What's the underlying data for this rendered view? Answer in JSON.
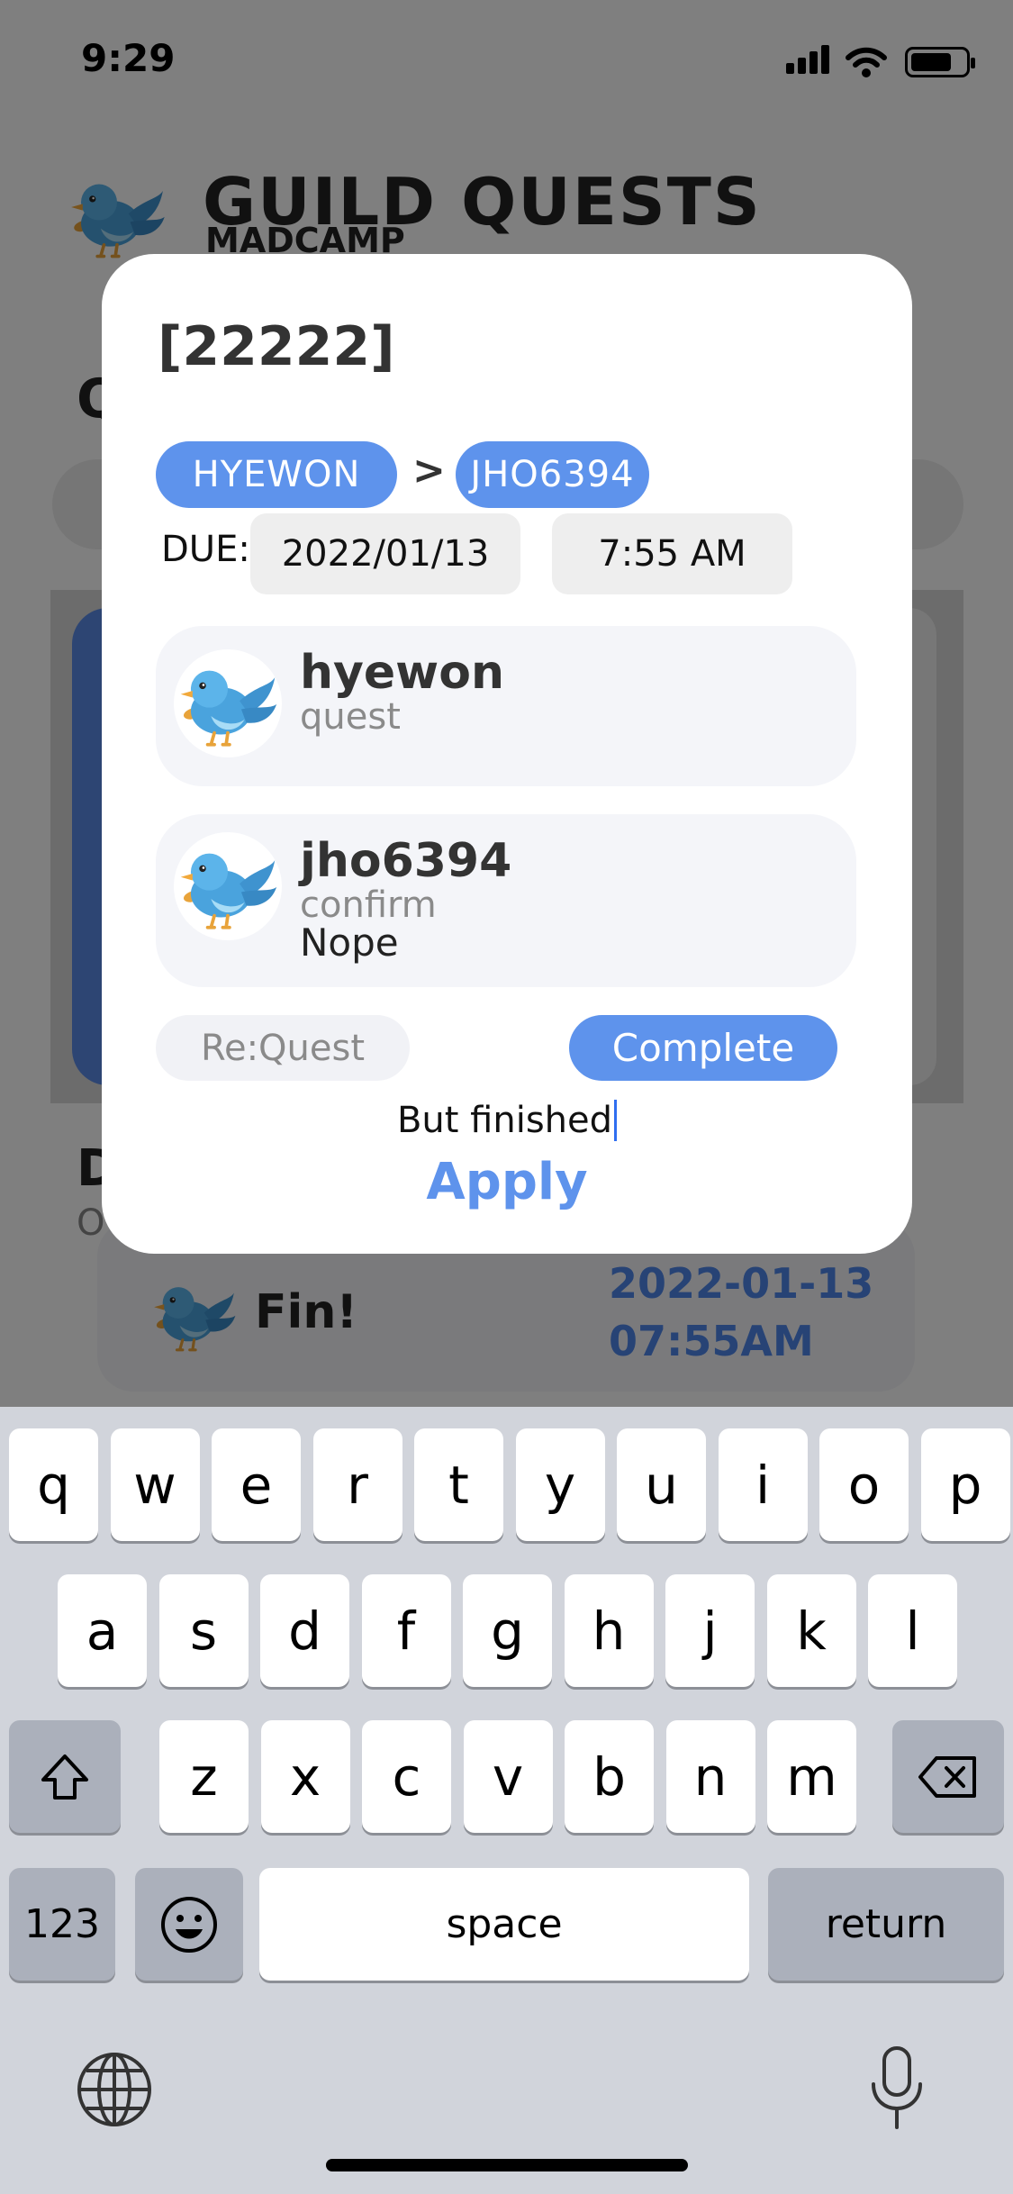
{
  "status_bar": {
    "time": "9:29"
  },
  "app": {
    "title": "GUILD QUESTS",
    "subtitle": "MADCAMP",
    "section_initial": "Q",
    "done_section_initial": "D",
    "done_section_sub_initial": "O",
    "done_item": {
      "label": "Fin!",
      "date": "2022-01-13",
      "time": "07:55AM"
    }
  },
  "dialog": {
    "title": "[22222]",
    "from_chip": "HYEWON",
    "separator": ">",
    "to_chip": "JHO6394",
    "due_label": "DUE:",
    "due_date": "2022/01/13",
    "due_time": "7:55 AM",
    "cards": [
      {
        "name": "hyewon",
        "role": "quest",
        "message": ""
      },
      {
        "name": "jho6394",
        "role": "confirm",
        "message": "Nope"
      }
    ],
    "request_button": "Re:Quest",
    "complete_button": "Complete",
    "input_value": "But finished",
    "apply_button": "Apply",
    "accent_color": "#5e93ec"
  },
  "keyboard": {
    "row1": [
      "q",
      "w",
      "e",
      "r",
      "t",
      "y",
      "u",
      "i",
      "o",
      "p"
    ],
    "row2": [
      "a",
      "s",
      "d",
      "f",
      "g",
      "h",
      "j",
      "k",
      "l"
    ],
    "row3": [
      "z",
      "x",
      "c",
      "v",
      "b",
      "n",
      "m"
    ],
    "numbers_key": "123",
    "space_key": "space",
    "return_key": "return",
    "shift_icon": "shift-icon",
    "delete_icon": "delete-icon",
    "emoji_icon": "emoji-icon",
    "globe_icon": "globe-icon",
    "mic_icon": "microphone-icon"
  }
}
